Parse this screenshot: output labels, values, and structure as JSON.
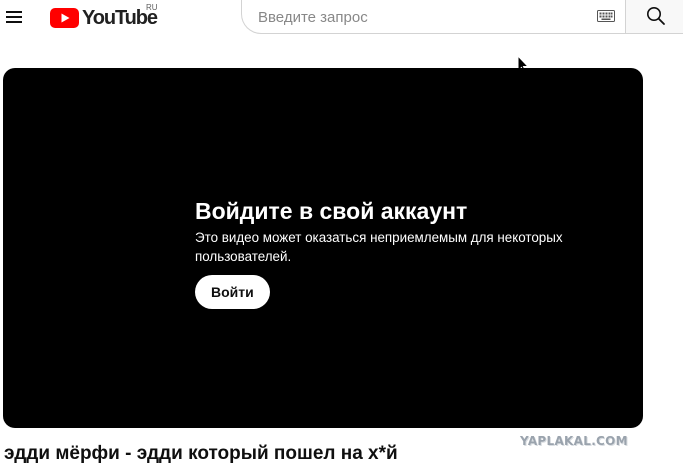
{
  "header": {
    "logo_text": "YouTube",
    "region": "RU",
    "search": {
      "value": "",
      "placeholder": "Введите запрос"
    },
    "icons": {
      "menu": "hamburger-menu-icon",
      "keyboard": "keyboard-icon",
      "search": "search-icon",
      "logo": "youtube-play-icon"
    },
    "colors": {
      "brand_red": "#ff0000",
      "text": "#0f0f0f"
    }
  },
  "player": {
    "title": "Войдите в свой аккаунт",
    "message": "Это видео может оказаться неприемлемым для некоторых пользователей.",
    "signin_button": "Войти",
    "background": "#000000"
  },
  "video": {
    "title": "эдди мёрфи - эдди который пошел на х*й"
  },
  "watermark": "YAPLAKAL.COM"
}
